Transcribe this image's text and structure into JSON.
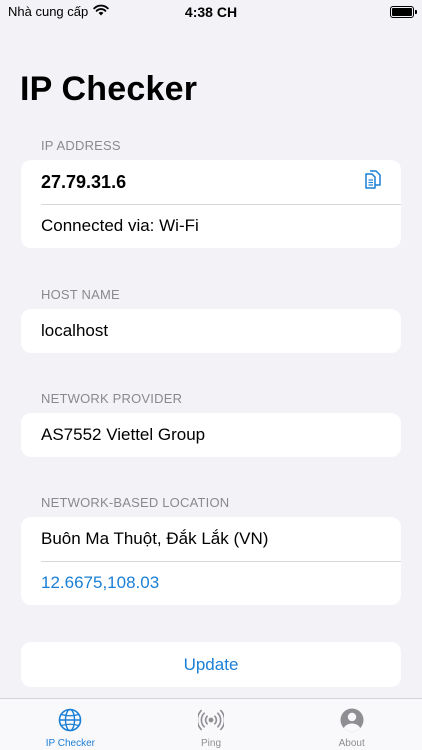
{
  "status_bar": {
    "carrier": "Nhà cung cấp",
    "time": "4:38 CH"
  },
  "page": {
    "title": "IP Checker"
  },
  "ip_address": {
    "header": "IP ADDRESS",
    "value": "27.79.31.6",
    "connection": "Connected via: Wi-Fi",
    "copy_icon": "copy-icon"
  },
  "host_name": {
    "header": "HOST NAME",
    "value": "localhost"
  },
  "network_provider": {
    "header": "NETWORK PROVIDER",
    "value": "AS7552 Viettel Group"
  },
  "location": {
    "header": "NETWORK-BASED LOCATION",
    "place": "Buôn Ma Thuột, Đắk Lắk (VN)",
    "coordinates": "12.6675,108.03"
  },
  "update_label": "Update",
  "tabs": [
    {
      "label": "IP Checker",
      "icon": "globe-icon",
      "active": true
    },
    {
      "label": "Ping",
      "icon": "broadcast-icon",
      "active": false
    },
    {
      "label": "About",
      "icon": "person-circle-icon",
      "active": false
    }
  ],
  "colors": {
    "accent": "#1a7fd6",
    "background": "#f2f2f7",
    "secondary_text": "#8a8a8e"
  }
}
